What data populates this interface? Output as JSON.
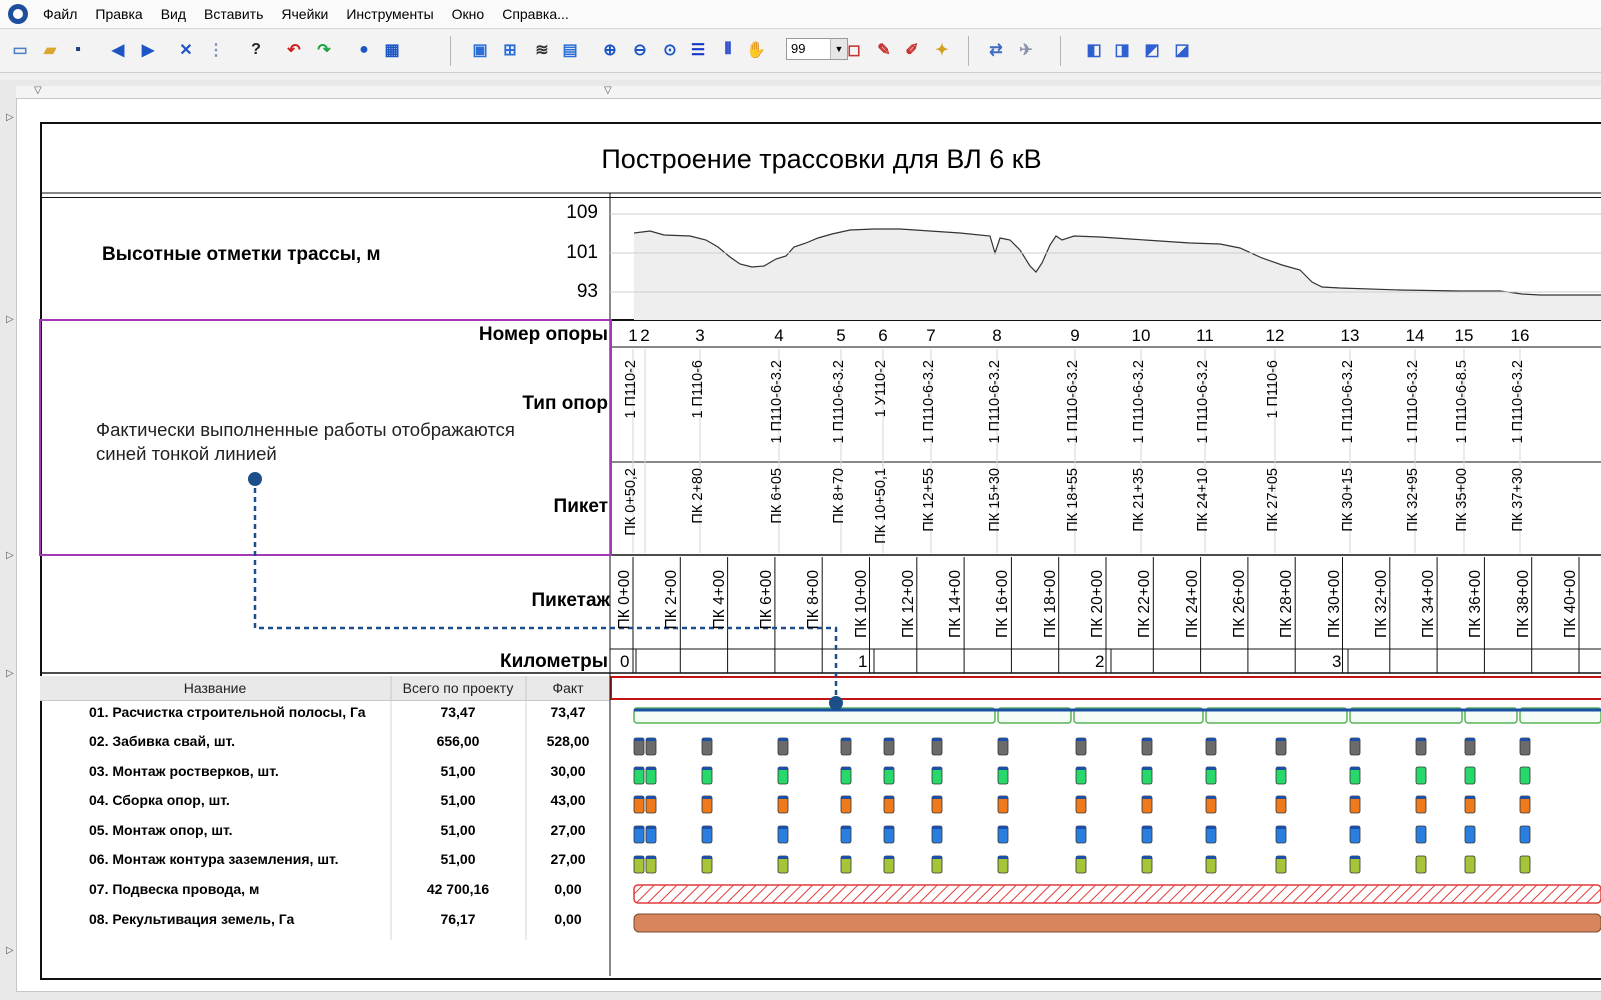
{
  "menu": [
    "Файл",
    "Правка",
    "Вид",
    "Вставить",
    "Ячейки",
    "Инструменты",
    "Окно",
    "Справка..."
  ],
  "toolbar": {
    "zoom_value": "99",
    "icons": [
      "new-file-icon",
      "open-folder-icon",
      "save-icon",
      "back-arrow-icon",
      "forward-arrow-icon",
      "tools-icon",
      "grid-dots-icon",
      "help-pointer-icon",
      "undo-icon",
      "redo-icon",
      "user-icon",
      "table-icon",
      "chart-icon",
      "grid-icon",
      "filter-icon",
      "export-icon",
      "zoom-in-icon",
      "zoom-out-icon",
      "zoom-fit-icon",
      "rows-icon",
      "columns-icon",
      "hand-icon",
      "page-icon",
      "edit-icon",
      "pencil-icon",
      "star-tool-icon",
      "link-tool-icon",
      "plane-icon",
      "layer-1-icon",
      "layer-2-icon",
      "layer-3-icon",
      "layer-4-icon"
    ]
  },
  "doc": {
    "title": "Построение трассовки для ВЛ 6 кВ",
    "elevation_label": "Высотные отметки трассы, м",
    "elevation_ticks": [
      "109",
      "101",
      "93"
    ],
    "support_number_label": "Номер опоры",
    "support_type_label": "Тип опор",
    "picket_label": "Пикет",
    "chainage_label": "Пикетаж",
    "km_label": "Километры",
    "annotation": "Фактически выполненные работы отображаются синей тонкой линией"
  },
  "supports": [
    {
      "num": "1",
      "type": "1 П110-2",
      "picket": "ПК 0+50,2"
    },
    {
      "num": "2",
      "type": "",
      "picket": ""
    },
    {
      "num": "3",
      "type": "1 П110-6",
      "picket": "ПК 2+80"
    },
    {
      "num": "4",
      "type": "1 П110-6-3.2",
      "picket": "ПК 6+05"
    },
    {
      "num": "5",
      "type": "1 П110-6-3.2",
      "picket": "ПК 8+70"
    },
    {
      "num": "6",
      "type": "1 У110-2",
      "picket": "ПК 10+50,1"
    },
    {
      "num": "7",
      "type": "1 П110-6-3.2",
      "picket": "ПК 12+55"
    },
    {
      "num": "8",
      "type": "1 П110-6-3.2",
      "picket": "ПК 15+30"
    },
    {
      "num": "9",
      "type": "1 П110-6-3.2",
      "picket": "ПК 18+55"
    },
    {
      "num": "10",
      "type": "1 П110-6-3.2",
      "picket": "ПК 21+35"
    },
    {
      "num": "11",
      "type": "1 П110-6-3.2",
      "picket": "ПК 24+10"
    },
    {
      "num": "12",
      "type": "1 П110-6",
      "picket": "ПК 27+05"
    },
    {
      "num": "13",
      "type": "1 П110-6-3.2",
      "picket": "ПК 30+15"
    },
    {
      "num": "14",
      "type": "1 П110-6-3.2",
      "picket": "ПК 32+95"
    },
    {
      "num": "15",
      "type": "1 П110-6-8.5",
      "picket": "ПК 35+00"
    },
    {
      "num": "16",
      "type": "1 П110-6-3.2",
      "picket": "ПК 37+30"
    }
  ],
  "chainage": [
    "ПК 0+00",
    "ПК 2+00",
    "ПК 4+00",
    "ПК 6+00",
    "ПК 8+00",
    "ПК 10+00",
    "ПК 12+00",
    "ПК 14+00",
    "ПК 16+00",
    "ПК 18+00",
    "ПК 20+00",
    "ПК 22+00",
    "ПК 24+00",
    "ПК 26+00",
    "ПК 28+00",
    "ПК 30+00",
    "ПК 32+00",
    "ПК 34+00",
    "ПК 36+00",
    "ПК 38+00",
    "ПК 40+00"
  ],
  "km": [
    "0",
    "1",
    "2",
    "3"
  ],
  "table": {
    "headers": [
      "Название",
      "Всего по проекту",
      "Факт"
    ],
    "rows": [
      {
        "name": "01. Расчистка строительной полосы, Га",
        "total": "73,47",
        "fact": "73,47"
      },
      {
        "name": "02. Забивка свай, шт.",
        "total": "656,00",
        "fact": "528,00"
      },
      {
        "name": "03. Монтаж ростверков, шт.",
        "total": "51,00",
        "fact": "30,00"
      },
      {
        "name": "04. Сборка опор, шт.",
        "total": "51,00",
        "fact": "43,00"
      },
      {
        "name": "05. Монтаж опор, шт.",
        "total": "51,00",
        "fact": "27,00"
      },
      {
        "name": "06. Монтаж контура заземления, шт.",
        "total": "51,00",
        "fact": "27,00"
      },
      {
        "name": "07. Подвеска провода, м",
        "total": "42 700,16",
        "fact": "0,00"
      },
      {
        "name": "08. Рекультивация земель, Га",
        "total": "76,17",
        "fact": "0,00"
      }
    ]
  },
  "colors": {
    "row2": "#6b6b6b",
    "row3": "#27d86a",
    "row4": "#ee7a1c",
    "row5": "#2a7ee0",
    "row6": "#a5c437",
    "blue_line": "#1c4fa6",
    "annot_line": "#1c4f8a",
    "clearing_bar": "#56b356",
    "wire_hatch": "#e23a3a",
    "recult": "#d8855e"
  }
}
